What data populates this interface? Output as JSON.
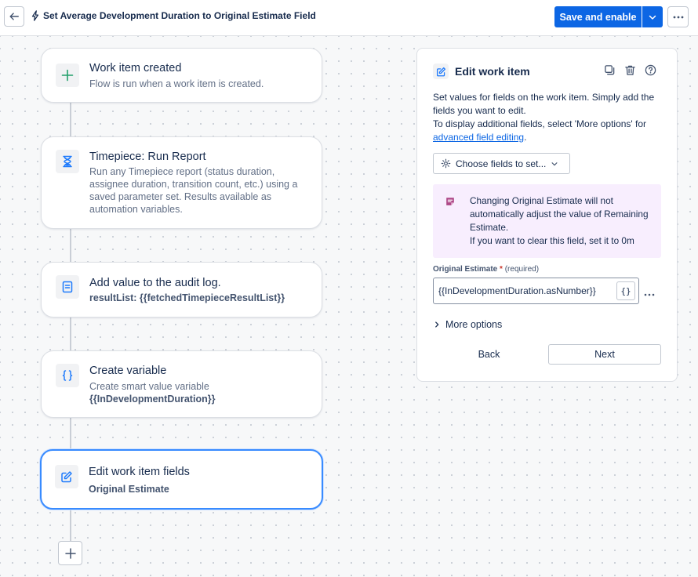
{
  "header": {
    "title": "Set Average Development Duration to Original Estimate Field",
    "save_label": "Save and enable"
  },
  "flow": {
    "steps": [
      {
        "title": "Work item created",
        "description": "Flow is run when a work item is created."
      },
      {
        "title": "Timepiece: Run Report",
        "description": "Run any Timepiece report (status duration, assignee duration, transition count, etc.) using a saved parameter set. Results available as automation variables."
      },
      {
        "title": "Add value to the audit log.",
        "description_prefix": "resultList: ",
        "description_value": "{{fetchedTimepieceResultList}}"
      },
      {
        "title": "Create variable",
        "description": "Create smart value variable",
        "description_value": "{{InDevelopmentDuration}}"
      },
      {
        "title": "Edit work item fields",
        "description": "Original Estimate"
      }
    ]
  },
  "panel": {
    "title": "Edit work item",
    "desc_line1": "Set values for fields on the work item. Simply add the fields you want to edit.",
    "desc_line2": "To display additional fields, select 'More options' for",
    "desc_link": "advanced field editing",
    "desc_end": ".",
    "choose_label": "Choose fields to set...",
    "notice_line1": "Changing Original Estimate will not automatically adjust the value of Remaining Estimate.",
    "notice_line2": "If you want to clear this field, set it to 0m",
    "field_label": "Original Estimate",
    "field_required_mark": "*",
    "field_required_text": "(required)",
    "field_value": "{{InDevelopmentDuration.asNumber}}",
    "smart_value_label": "{}",
    "more_options_label": "More options",
    "back_label": "Back",
    "next_label": "Next"
  },
  "colors": {
    "primary": "#0c66e4",
    "selected_border": "#388bff",
    "notice_bg": "#f8eefe",
    "notice_icon": "#ae4787",
    "trigger_icon": "#22a06b",
    "action_icon": "#1d7afc"
  }
}
